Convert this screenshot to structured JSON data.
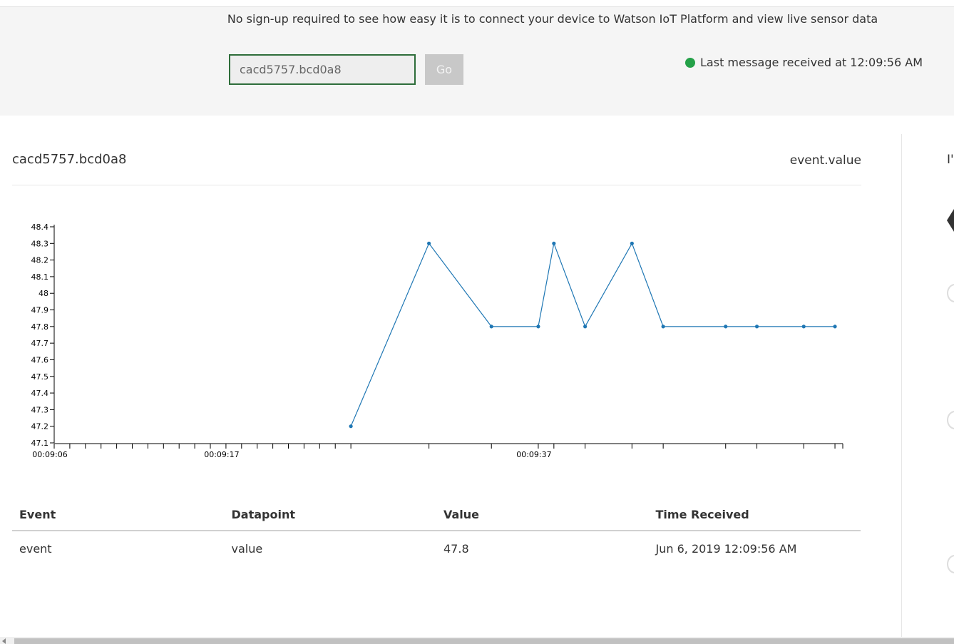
{
  "header": {
    "tagline": "No sign-up required to see how easy it is to connect your device to Watson IoT Platform and view live sensor data",
    "device_input_value": "cacd5757.bcd0a8",
    "go_label": "Go",
    "status_text": "Last message received at 12:09:56 AM",
    "status_color": "#24a148"
  },
  "panel": {
    "device_title": "cacd5757.bcd0a8",
    "metric_label": "event.value"
  },
  "side": {
    "partial_text": "I'"
  },
  "chart_data": {
    "type": "line",
    "x_tick_labels": [
      "00:09:06",
      "00:09:17",
      "00:09:37"
    ],
    "y_ticks": [
      "47.1",
      "47.2",
      "47.3",
      "47.4",
      "47.5",
      "47.6",
      "47.7",
      "47.8",
      "47.9",
      "48",
      "48.1",
      "48.2",
      "48.3",
      "48.4"
    ],
    "ylim": [
      47.1,
      48.4
    ],
    "xlim_seconds": [
      0,
      50.5
    ],
    "series_color": "#1f77b4",
    "points_seconds": [
      19,
      24,
      28,
      31,
      32,
      34,
      37,
      39,
      43,
      45,
      48,
      50
    ],
    "values": [
      47.2,
      48.3,
      47.8,
      47.8,
      48.3,
      47.8,
      48.3,
      47.8,
      47.8,
      47.8,
      47.8,
      47.8
    ],
    "x_tick_seconds": [
      0,
      1,
      2,
      3,
      4,
      5,
      6,
      7,
      8,
      9,
      10,
      11,
      12,
      13,
      14,
      15,
      16,
      17,
      18,
      19,
      24,
      28,
      31,
      32,
      34,
      37,
      39,
      43,
      45,
      48,
      50,
      50.5
    ]
  },
  "table": {
    "headers": [
      "Event",
      "Datapoint",
      "Value",
      "Time Received"
    ],
    "rows": [
      [
        "event",
        "value",
        "47.8",
        "Jun 6, 2019 12:09:56 AM"
      ]
    ]
  }
}
